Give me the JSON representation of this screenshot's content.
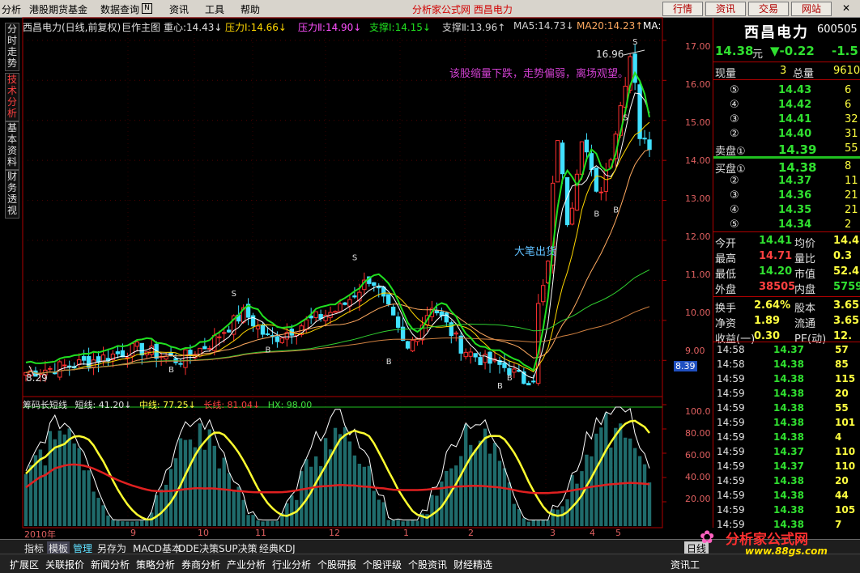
{
  "menu": {
    "items": [
      "分析",
      "港股期货基金",
      "数据查询",
      "资讯",
      "工具",
      "帮助"
    ],
    "brand": "分析家公式网 西昌电力",
    "buttons": [
      "行情",
      "资讯",
      "交易",
      "网站"
    ]
  },
  "leftnav": {
    "tabs": [
      "分时走势",
      "技术分析",
      "基本资料",
      "财务透视"
    ]
  },
  "chart": {
    "info": {
      "name": "西昌电力(日线,前复权)",
      "main": "巨作主图",
      "zx": "重心:14.43↓",
      "yl1": "压力Ⅰ:14.66↓",
      "yl2": "压力Ⅱ:14.90↓",
      "zc1": "支撑Ⅰ:14.15↓",
      "zc2": "支撑Ⅱ:13.96↑",
      "ma5": "MA5:14.73↓",
      "ma20": "MA20:14.23↑",
      "ma": "MA:"
    },
    "price_axis": [
      "17.00",
      "16.00",
      "15.00",
      "14.00",
      "13.00",
      "12.00",
      "11.00",
      "10.00",
      "9.00"
    ],
    "current_price": "8.39",
    "annotations": {
      "comment": "该股缩量下跌，走势偏弱，离场观望。",
      "high": "16.96",
      "low": "8.29",
      "big": "大笔出货"
    },
    "time_axis": [
      "2010年",
      "9",
      "10",
      "11",
      "12",
      "1",
      "2",
      "3",
      "4",
      "5"
    ],
    "sub": {
      "title": "筹码长短线",
      "short": "短线: 41.20↓",
      "mid": "中线: 77.25↓",
      "long": "长线: 81.04↓",
      "hx": "HX: 98.00",
      "axis": [
        "100.0",
        "80.00",
        "60.00",
        "40.00",
        "20.00"
      ]
    }
  },
  "chart_data": {
    "type": "candlestick",
    "title": "西昌电力(日线,前复权)",
    "ylim": [
      8.5,
      17.2
    ],
    "high": 16.96,
    "low": 8.29,
    "ma": {
      "MA5": 14.73,
      "MA20": 14.23
    },
    "sub_indicator": {
      "short": 41.2,
      "mid": 77.25,
      "long": 81.04,
      "hx": 98.0,
      "ylim": [
        0,
        100
      ]
    }
  },
  "right": {
    "name": "西昌电力",
    "code": "600505",
    "price": "14.38",
    "unit": "元",
    "change": "▼-0.22",
    "pct": "-1.5",
    "vol_label": "现量",
    "vol": "3",
    "total_label": "总量",
    "total": "9610",
    "sells": [
      [
        "⑤",
        "14.43",
        "6"
      ],
      [
        "④",
        "14.42",
        "6"
      ],
      [
        "③",
        "14.41",
        "32"
      ],
      [
        "②",
        "14.40",
        "31"
      ],
      [
        "卖盘①",
        "14.39",
        "55"
      ]
    ],
    "buys": [
      [
        "买盘①",
        "14.38",
        "8"
      ],
      [
        "②",
        "14.37",
        "11"
      ],
      [
        "③",
        "14.36",
        "21"
      ],
      [
        "④",
        "14.35",
        "21"
      ],
      [
        "⑤",
        "14.34",
        "2"
      ]
    ],
    "stats": [
      [
        "今开",
        "14.41",
        "均价",
        "14.4"
      ],
      [
        "最高",
        "14.71",
        "量比",
        "0.3"
      ],
      [
        "最低",
        "14.20",
        "市值",
        "52.4"
      ],
      [
        "外盘",
        "38505",
        "内盘",
        "5759"
      ],
      [
        "换手",
        "2.64%",
        "股本",
        "3.65"
      ],
      [
        "净资",
        "1.89",
        "流通",
        "3.65"
      ],
      [
        "收益(一)",
        "0.30",
        "PE(动)",
        "12."
      ]
    ],
    "ticks": [
      [
        "14:58",
        "14.37",
        "57"
      ],
      [
        "14:58",
        "14.38",
        "85"
      ],
      [
        "14:59",
        "14.38",
        "115"
      ],
      [
        "14:59",
        "14.38",
        "20"
      ],
      [
        "14:59",
        "14.38",
        "55"
      ],
      [
        "14:59",
        "14.38",
        "101"
      ],
      [
        "14:59",
        "14.38",
        "4"
      ],
      [
        "14:59",
        "14.37",
        "110"
      ],
      [
        "14:59",
        "14.37",
        "110"
      ],
      [
        "14:59",
        "14.38",
        "20"
      ],
      [
        "14:59",
        "14.38",
        "44"
      ],
      [
        "14:59",
        "14.38",
        "105"
      ],
      [
        "14:59",
        "14.38",
        "7"
      ]
    ]
  },
  "bottom": {
    "tabs1": [
      "指标",
      "模板",
      "管理",
      "另存为",
      "MACD基本",
      "DDE决策",
      "SUP决策",
      "经典KDJ"
    ],
    "day": "日线",
    "tabs2": [
      "扩展区",
      "关联报价",
      "新闻分析",
      "策略分析",
      "券商分析",
      "产业分析",
      "行业分析",
      "个股研报",
      "个股评级",
      "个股资讯",
      "财经精选"
    ],
    "right": "资讯工"
  },
  "watermark": {
    "site": "分析家公式网",
    "url": "www.88gs.com"
  }
}
